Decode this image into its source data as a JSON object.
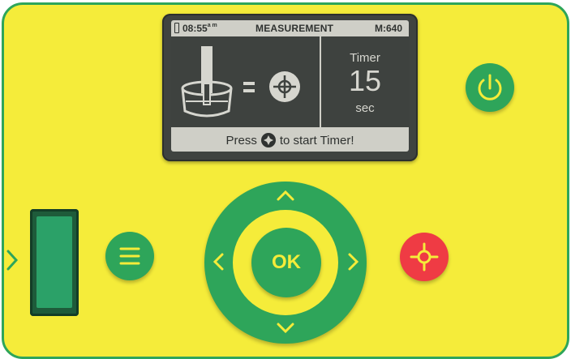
{
  "display": {
    "time": "08:55",
    "time_suffix": "a m",
    "title": "MEASUREMENT",
    "memory": "M:640",
    "timer_label": "Timer",
    "timer_value": "15",
    "timer_unit": "sec",
    "footer_prefix": "Press",
    "footer_suffix": "to start Timer!",
    "equals": "="
  },
  "buttons": {
    "ok_label": "OK",
    "power_icon": "power-icon",
    "menu_icon": "menu-icon",
    "measure_icon": "crosshair-icon"
  },
  "colors": {
    "panel": "#f5ec3a",
    "button_green": "#2ea55a",
    "button_red": "#ef3b44",
    "lcd_background": "#cfcfc7",
    "lcd_dark": "#3e423f"
  }
}
